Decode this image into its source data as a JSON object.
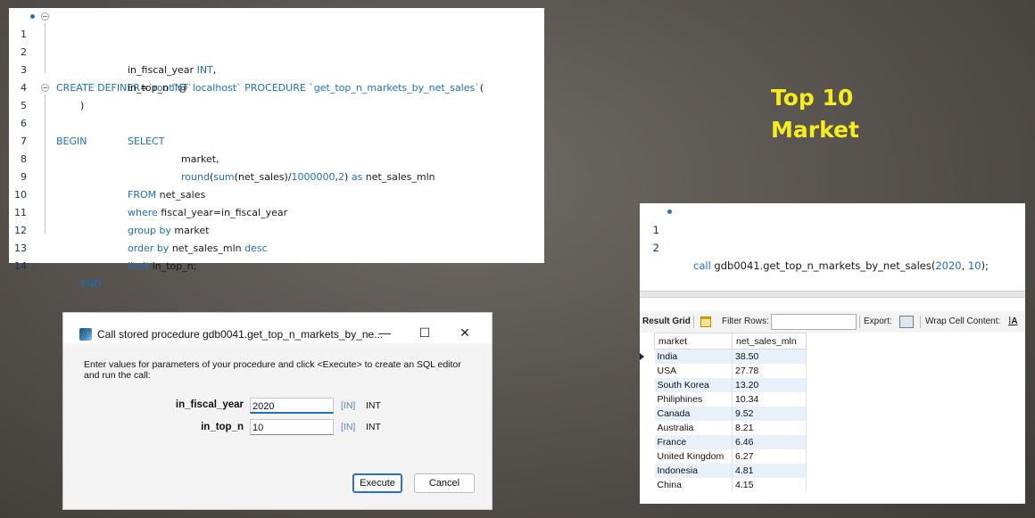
{
  "editor": {
    "lines": [
      {
        "n": "1",
        "code": "CREATE DEFINER=`root`@`localhost` PROCEDURE `get_top_n_markets_by_net_sales`("
      },
      {
        "n": "2",
        "code": "in_fiscal_year INT,"
      },
      {
        "n": "3",
        "code": "in_top_n INT"
      },
      {
        "n": "4",
        "code": ")"
      },
      {
        "n": "5",
        "code": "BEGIN"
      },
      {
        "n": "6",
        "code": "SELECT"
      },
      {
        "n": "7",
        "code": "market,"
      },
      {
        "n": "8",
        "code": "round(sum(net_sales)/1000000,2) as net_sales_mln"
      },
      {
        "n": "9",
        "code": "FROM net_sales"
      },
      {
        "n": "10",
        "code": "where fiscal_year=in_fiscal_year"
      },
      {
        "n": "11",
        "code": "group by market"
      },
      {
        "n": "12",
        "code": "order by net_sales_mln desc"
      },
      {
        "n": "13",
        "code": "limit in_top_n;"
      },
      {
        "n": "14",
        "code": "END"
      }
    ]
  },
  "title": {
    "line1": "Top 10",
    "line2": "Market"
  },
  "call_editor": {
    "lines": [
      {
        "n": "1",
        "code": "call gdb0041.get_top_n_markets_by_net_sales(2020, 10);"
      },
      {
        "n": "2",
        "code": ""
      }
    ]
  },
  "result_grid": {
    "toolbar": {
      "result_grid_label": "Result Grid",
      "filter_label": "Filter Rows:",
      "filter_value": "",
      "export_label": "Export:",
      "wrap_label": "Wrap Cell Content:"
    },
    "columns": [
      "market",
      "net_sales_mln"
    ],
    "rows": [
      [
        "India",
        "38.50"
      ],
      [
        "USA",
        "27.78"
      ],
      [
        "South Korea",
        "13.20"
      ],
      [
        "Philiphines",
        "10.34"
      ],
      [
        "Canada",
        "9.52"
      ],
      [
        "Australia",
        "8.21"
      ],
      [
        "France",
        "6.46"
      ],
      [
        "United Kingdom",
        "6.27"
      ],
      [
        "Indonesia",
        "4.81"
      ],
      [
        "China",
        "4.15"
      ]
    ]
  },
  "dialog": {
    "title": "Call stored procedure gdb0041.get_top_n_markets_by_ne...",
    "minimize": "—",
    "maximize": "☐",
    "close": "✕",
    "instructions": "Enter values for parameters of your procedure and click <Execute> to create an SQL editor and run the call:",
    "params": [
      {
        "label": "in_fiscal_year",
        "value": "2020",
        "mode": "[IN]",
        "type": "INT"
      },
      {
        "label": "in_top_n",
        "value": "10",
        "mode": "[IN]",
        "type": "INT"
      }
    ],
    "execute_label": "Execute",
    "cancel_label": "Cancel"
  }
}
